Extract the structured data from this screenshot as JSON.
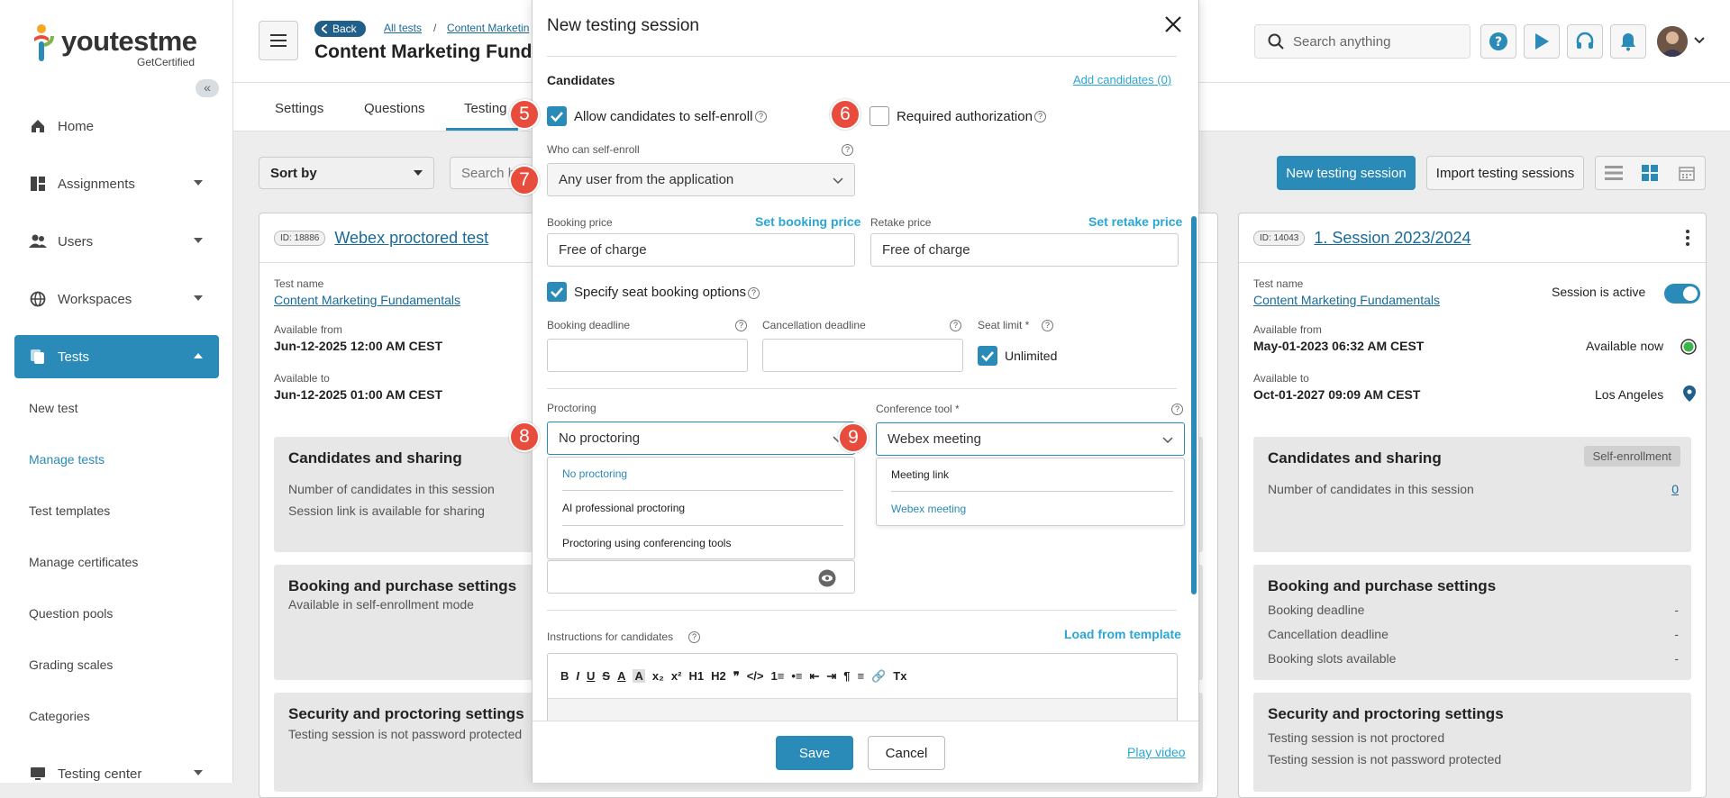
{
  "brand": {
    "name": "youtestme",
    "sub": "GetCertified",
    "accent": "#2a8ab8"
  },
  "sidebar": {
    "items": [
      {
        "label": "Home"
      },
      {
        "label": "Assignments"
      },
      {
        "label": "Users"
      },
      {
        "label": "Workspaces"
      },
      {
        "label": "Tests"
      }
    ],
    "sub_items": [
      "New test",
      "Manage tests",
      "Test templates",
      "Manage certificates",
      "Question pools",
      "Grading scales",
      "Categories"
    ],
    "testing_center": "Testing center"
  },
  "header": {
    "back": "Back",
    "crumb1": "All tests",
    "crumb_sep": "/",
    "crumb2": "Content Marketin",
    "title": "Content Marketing Fundan",
    "search_placeholder": "Search anything"
  },
  "tabs": [
    "Settings",
    "Questions",
    "Testing"
  ],
  "toolbar": {
    "sort_by": "Sort by",
    "search_by": "Search b",
    "new_session": "New testing session",
    "import_sessions": "Import testing sessions"
  },
  "card_left": {
    "id": "ID: 18886",
    "title": "Webex proctored test",
    "test_name_label": "Test name",
    "test_name": "Content Marketing Fundamentals",
    "available_from_label": "Available from",
    "available_from": "Jun-12-2025 12:00 AM CEST",
    "available_to_label": "Available to",
    "available_to": "Jun-12-2025 01:00 AM CEST",
    "cands_title": "Candidates and sharing",
    "cands_line1": "Number of candidates in this session",
    "cands_line2": "Session link is available for sharing",
    "booking_title": "Booking and purchase settings",
    "booking_line1": "Available in self-enrollment mode",
    "security_title": "Security and proctoring settings",
    "security_line1": "Testing session is not password protected"
  },
  "card_right": {
    "id": "ID: 14043",
    "title": "1. Session 2023/2024",
    "test_name_label": "Test name",
    "test_name": "Content Marketing Fundamentals",
    "session_active": "Session is active",
    "available_from_label": "Available from",
    "available_from": "May-01-2023 06:32 AM CEST",
    "available_now": "Available now",
    "available_to_label": "Available to",
    "available_to": "Oct-01-2027 09:09 AM CEST",
    "location": "Los Angeles",
    "cands_title": "Candidates and sharing",
    "self_enrollment": "Self-enrollment",
    "cands_line1": "Number of candidates in this session",
    "cands_count": "0",
    "booking_title": "Booking and purchase settings",
    "booking_deadline": "Booking deadline",
    "cancellation_deadline": "Cancellation deadline",
    "booking_slots": "Booking slots available",
    "dash": "-",
    "security_title": "Security and proctoring settings",
    "security_line1": "Testing session is not proctored",
    "security_line2": "Testing session is not password protected"
  },
  "modal": {
    "title": "New testing session",
    "candidates": "Candidates",
    "add_candidates": "Add candidates (0)",
    "allow_self_enroll": "Allow candidates to self-enroll",
    "required_auth": "Required authorization",
    "who_can_label": "Who can self-enroll",
    "who_can_value": "Any user from the application",
    "booking_price_label": "Booking price",
    "set_booking_price": "Set booking price",
    "booking_price_value": "Free of charge",
    "retake_price_label": "Retake price",
    "set_retake_price": "Set retake price",
    "retake_price_value": "Free of charge",
    "seat_booking": "Specify seat booking options",
    "booking_deadline": "Booking deadline",
    "cancellation_deadline": "Cancellation deadline",
    "seat_limit": "Seat limit *",
    "unlimited": "Unlimited",
    "proctoring_label": "Proctoring",
    "proctoring_value": "No proctoring",
    "proctoring_options": [
      "No proctoring",
      "AI professional proctoring",
      "Proctoring using conferencing tools"
    ],
    "conference_label": "Conference tool *",
    "conference_value": "Webex meeting",
    "conference_options": [
      "Meeting link",
      "Webex meeting"
    ],
    "instructions_label": "Instructions for candidates",
    "load_template": "Load from template",
    "rte_tools": [
      "B",
      "I",
      "U",
      "S",
      "A",
      "A",
      "x₂",
      "x²",
      "H1",
      "H2",
      "❞",
      "</>",
      "1≡",
      "•≡",
      "⇤",
      "⇥",
      "¶",
      "≡",
      "🔗",
      "Tx"
    ],
    "save": "Save",
    "cancel": "Cancel",
    "play_video": "Play video"
  },
  "badges": [
    "5",
    "6",
    "7",
    "8",
    "9"
  ],
  "colors": {
    "badge": "#e84c3d",
    "accent": "#2a8ab8",
    "link": "#2aa6d4"
  }
}
